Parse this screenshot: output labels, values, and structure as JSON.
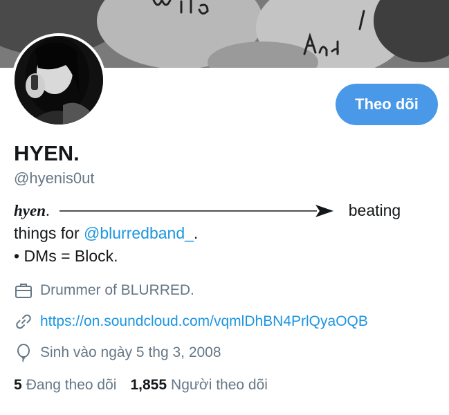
{
  "header": {
    "banner_text": "Wild And"
  },
  "profile": {
    "display_name": "HYEN.",
    "handle": "@hyenis0ut",
    "follow_label": "Theo dõi"
  },
  "bio": {
    "script": "hyen",
    "dot": ".",
    "line1_end": "beating",
    "line2_prefix": "things for ",
    "line2_mention": "@blurredband_",
    "line2_suffix": ".",
    "line3": "• DMs = Block."
  },
  "meta": {
    "occupation": "Drummer of BLURRED.",
    "link": "https://on.soundcloud.com/vqmlDhBN4PrlQyaOQB",
    "birthday": "Sinh vào ngày 5 thg 3, 2008"
  },
  "stats": {
    "following_count": "5",
    "following_label": "Đang theo dõi",
    "followers_count": "1,855",
    "followers_label": "Người theo dõi"
  },
  "colors": {
    "accent": "#4a99e9",
    "link": "#1b95e0",
    "secondary_text": "#657786",
    "primary_text": "#14171a"
  },
  "icons": {
    "occupation": "briefcase-icon",
    "link": "link-icon",
    "birthday": "balloon-icon",
    "bio_arrow": "arrow-right-icon"
  }
}
